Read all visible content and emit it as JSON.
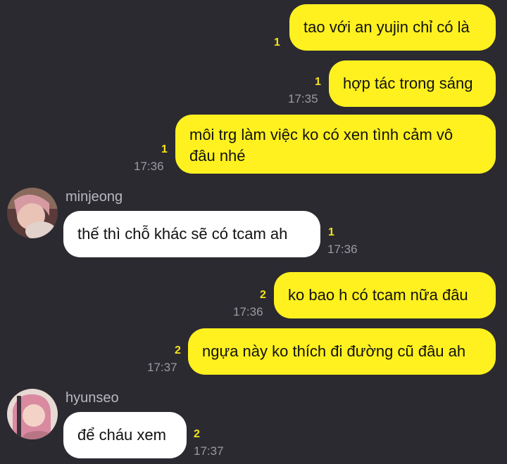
{
  "messages": [
    {
      "sender": "me",
      "text": "tao với an yujin chỉ có là",
      "unread": "1",
      "time": ""
    },
    {
      "sender": "me",
      "text": "hợp tác trong sáng",
      "unread": "1",
      "time": "17:35"
    },
    {
      "sender": "me",
      "text_line1": "môi trg làm việc ko có xen tình cảm vô",
      "text_line2": "đâu nhé",
      "unread": "1",
      "time": "17:36"
    },
    {
      "sender": "minjeong",
      "text": "thế thì chỗ khác sẽ có tcam ah",
      "unread": "1",
      "time": "17:36"
    },
    {
      "sender": "me",
      "text": "ko bao h có tcam nữa đâu",
      "unread": "2",
      "time": "17:36"
    },
    {
      "sender": "me",
      "text": "ngựa này ko thích đi đường cũ đâu ah",
      "unread": "2",
      "time": "17:37"
    },
    {
      "sender": "hyunseo",
      "text": "để cháu xem",
      "unread": "2",
      "time": "17:37"
    }
  ],
  "users": {
    "minjeong": {
      "name": "minjeong",
      "avatar_icon": "avatar-photo"
    },
    "hyunseo": {
      "name": "hyunseo",
      "avatar_icon": "avatar-photo"
    }
  },
  "colors": {
    "background": "#2b2a31",
    "my_bubble": "#fff11f",
    "their_bubble": "#ffffff",
    "unread": "#f5e31b",
    "timestamp": "#9b9aa1"
  }
}
